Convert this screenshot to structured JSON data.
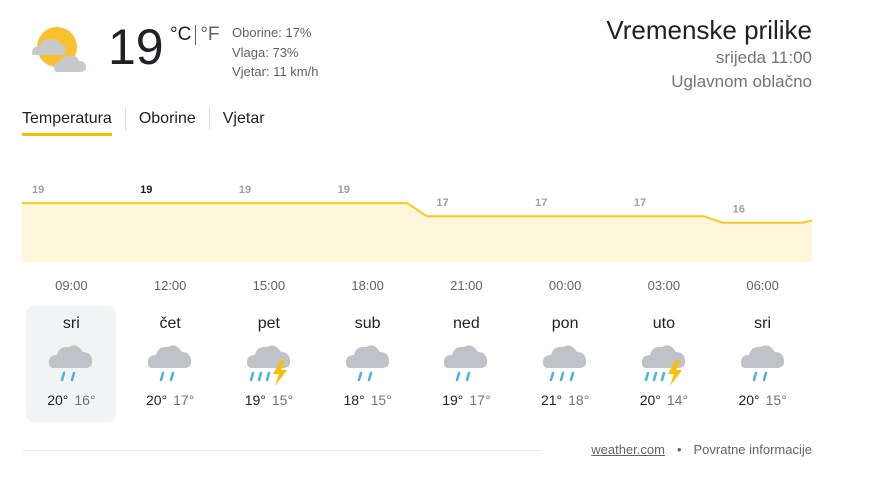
{
  "current": {
    "temp": "19",
    "unit_c": "°C",
    "unit_f": "°F",
    "precipitation": "Oborine: 17%",
    "humidity": "Vlaga: 73%",
    "wind": "Vjetar: 11 km/h",
    "icon": "partly-cloudy-icon"
  },
  "header": {
    "title": "Vremenske prilike",
    "datetime": "srijeda 11:00",
    "condition": "Uglavnom oblačno"
  },
  "tabs": [
    "Temperatura",
    "Oborine",
    "Vjetar"
  ],
  "active_tab": "Temperatura",
  "chart_data": {
    "type": "area",
    "x": [
      "09:00",
      "12:00",
      "15:00",
      "18:00",
      "21:00",
      "00:00",
      "03:00",
      "06:00"
    ],
    "values": [
      19,
      19,
      19,
      19,
      17,
      17,
      17,
      16
    ],
    "labels": [
      "19",
      "19",
      "19",
      "19",
      "17",
      "17",
      "17",
      "16"
    ],
    "highlight_index": 1,
    "line_color": "#f9c81e",
    "fill_color": "#fef7dc"
  },
  "days": [
    {
      "name": "sri",
      "hi": "20°",
      "lo": "16°",
      "icon": "rain-icon",
      "selected": true
    },
    {
      "name": "čet",
      "hi": "20°",
      "lo": "17°",
      "icon": "rain-icon"
    },
    {
      "name": "pet",
      "hi": "19°",
      "lo": "15°",
      "icon": "thunderstorm-icon"
    },
    {
      "name": "sub",
      "hi": "18°",
      "lo": "15°",
      "icon": "rain-icon"
    },
    {
      "name": "ned",
      "hi": "19°",
      "lo": "17°",
      "icon": "rain-icon"
    },
    {
      "name": "pon",
      "hi": "21°",
      "lo": "18°",
      "icon": "heavy-rain-icon"
    },
    {
      "name": "uto",
      "hi": "20°",
      "lo": "14°",
      "icon": "thunderstorm-icon"
    },
    {
      "name": "sri",
      "hi": "20°",
      "lo": "15°",
      "icon": "rain-icon"
    }
  ],
  "footer": {
    "source": "weather.com",
    "separator": "•",
    "feedback": "Povratne informacije"
  }
}
